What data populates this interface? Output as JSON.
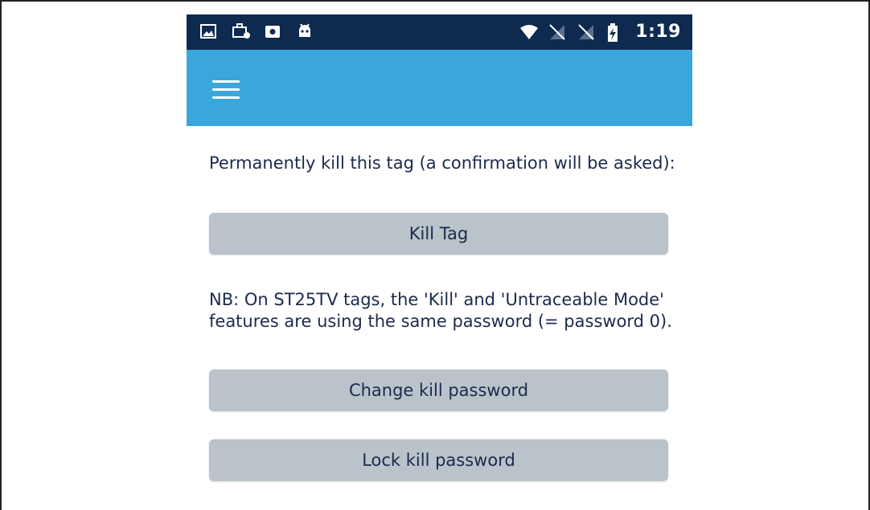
{
  "status_bar": {
    "time": "1:19",
    "left_icons": [
      "image-icon",
      "briefcase-icon",
      "record-icon",
      "android-icon"
    ],
    "right_icons": [
      "wifi-icon",
      "no-signal-icon",
      "no-signal-icon",
      "battery-charging-icon"
    ]
  },
  "app_bar": {
    "menu_icon": "hamburger-menu-icon",
    "color": "#3aa7dc"
  },
  "content": {
    "kill_description": "Permanently kill this tag (a confirmation will be asked):",
    "kill_button_label": "Kill Tag",
    "nb_note": "NB: On ST25TV tags, the 'Kill' and 'Untraceable Mode' features are using the same password (= password 0).",
    "change_password_button_label": "Change kill password",
    "lock_password_button_label": "Lock kill password"
  },
  "colors": {
    "status_bar_bg": "#0e2a4f",
    "app_bar_bg": "#3aa7dc",
    "button_bg": "#b9c3c9",
    "text": "#1b2a4e"
  }
}
